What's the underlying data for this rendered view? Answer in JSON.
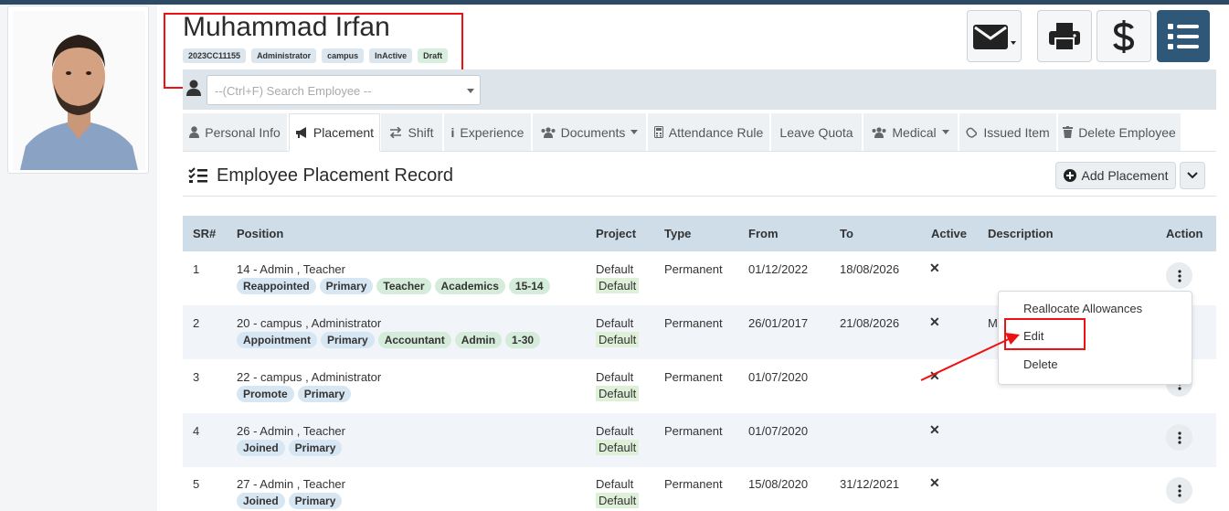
{
  "employee": {
    "name": "Muhammad Irfan",
    "badges": [
      {
        "label": "2023CC11155",
        "color": "#dbe6ee"
      },
      {
        "label": "Administrator",
        "color": "#dbe6ee"
      },
      {
        "label": "campus",
        "color": "#dbe6ee"
      },
      {
        "label": "InActive",
        "color": "#dbe6ee"
      },
      {
        "label": "Draft",
        "color": "#d8efe0"
      }
    ]
  },
  "header_actions": {
    "icons": [
      "envelope-dropdown-icon",
      "printer-icon",
      "dollar-icon",
      "list-icon"
    ]
  },
  "search": {
    "placeholder": "--(Ctrl+F) Search Employee --"
  },
  "tabs": [
    {
      "label": "Personal Info",
      "icon": "user-icon"
    },
    {
      "label": "Placement",
      "icon": "bullhorn-icon",
      "active": true
    },
    {
      "label": "Shift",
      "icon": "exchange-icon"
    },
    {
      "label": "Experience",
      "icon": "info-icon"
    },
    {
      "label": "Documents",
      "icon": "users-icon",
      "dropdown": true
    },
    {
      "label": "Attendance Rule",
      "icon": "calculator-icon"
    },
    {
      "label": "Leave Quota",
      "icon": ""
    },
    {
      "label": "Medical",
      "icon": "users-icon",
      "dropdown": true
    },
    {
      "label": "Issued Item",
      "icon": "handshake-icon"
    },
    {
      "label": "Delete Employee",
      "icon": "trash-icon"
    }
  ],
  "section": {
    "title": "Employee Placement Record",
    "add_label": "Add Placement"
  },
  "table": {
    "headers": [
      "SR#",
      "Position",
      "Project",
      "Type",
      "From",
      "To",
      "Active",
      "Description",
      "Action"
    ],
    "rows": [
      {
        "sr": "1",
        "position": "14 - Admin , Teacher",
        "tags": [
          {
            "t": "Reappointed",
            "c": "blue"
          },
          {
            "t": "Primary",
            "c": "blue"
          },
          {
            "t": "Teacher",
            "c": "green"
          },
          {
            "t": "Academics",
            "c": "green"
          },
          {
            "t": "15-14",
            "c": "green"
          }
        ],
        "project": "Default",
        "project_tag": "Default",
        "type": "Permanent",
        "from": "01/12/2022",
        "to": "18/08/2026",
        "active": "✕",
        "description": ""
      },
      {
        "sr": "2",
        "position": "20 - campus , Administrator",
        "tags": [
          {
            "t": "Appointment",
            "c": "blue"
          },
          {
            "t": "Primary",
            "c": "blue"
          },
          {
            "t": "Accountant",
            "c": "green"
          },
          {
            "t": "Admin",
            "c": "green"
          },
          {
            "t": "1-30",
            "c": "green"
          }
        ],
        "project": "Default",
        "project_tag": "Default",
        "type": "Permanent",
        "from": "26/01/2017",
        "to": "21/08/2026",
        "active": "✕",
        "description": "M"
      },
      {
        "sr": "3",
        "position": "22 - campus , Administrator",
        "tags": [
          {
            "t": "Promote",
            "c": "blue"
          },
          {
            "t": "Primary",
            "c": "blue"
          }
        ],
        "project": "Default",
        "project_tag": "Default",
        "type": "Permanent",
        "from": "01/07/2020",
        "to": "",
        "active": "✕",
        "description": ""
      },
      {
        "sr": "4",
        "position": "26 - Admin , Teacher",
        "tags": [
          {
            "t": "Joined",
            "c": "blue"
          },
          {
            "t": "Primary",
            "c": "blue"
          }
        ],
        "project": "Default",
        "project_tag": "Default",
        "type": "Permanent",
        "from": "01/07/2020",
        "to": "",
        "active": "✕",
        "description": ""
      },
      {
        "sr": "5",
        "position": "27 - Admin , Teacher",
        "tags": [
          {
            "t": "Joined",
            "c": "blue"
          },
          {
            "t": "Primary",
            "c": "blue"
          }
        ],
        "project": "Default",
        "project_tag": "Default",
        "type": "Permanent",
        "from": "15/08/2020",
        "to": "31/12/2021",
        "active": "✕",
        "description": ""
      }
    ]
  },
  "action_menu": {
    "items": [
      "Reallocate Allowances",
      "Edit",
      "Delete"
    ]
  },
  "annotation": {
    "color": "#e11111"
  }
}
